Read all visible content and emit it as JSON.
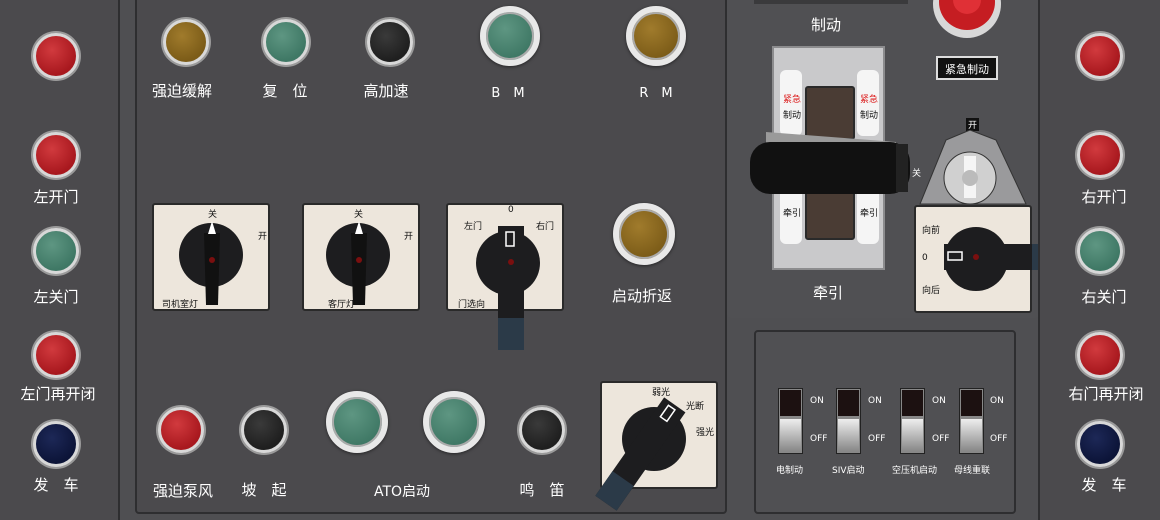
{
  "left_panel": {
    "buttons": [
      {
        "label": "",
        "color": "#a8181e"
      },
      {
        "label": "左开门",
        "color": "#a8181e"
      },
      {
        "label": "左关门",
        "color": "#3f7865"
      },
      {
        "label": "左门再开闭",
        "color": "#a8181e"
      },
      {
        "label": "发　车",
        "color": "#0c1438"
      }
    ]
  },
  "right_panel": {
    "buttons": [
      {
        "label": "",
        "color": "#a8181e"
      },
      {
        "label": "右开门",
        "color": "#a8181e"
      },
      {
        "label": "右关门",
        "color": "#3f7865"
      },
      {
        "label": "右门再开闭",
        "color": "#a8181e"
      },
      {
        "label": "发　车",
        "color": "#0c1438"
      }
    ]
  },
  "main": {
    "top_buttons": [
      {
        "label": "强迫缓解",
        "color": "gold"
      },
      {
        "label": "复　位",
        "color": "green"
      },
      {
        "label": "高加速",
        "color": "dark"
      },
      {
        "label": "B　M",
        "color": "green"
      },
      {
        "label": "R　M",
        "color": "gold"
      }
    ],
    "cab_light_switch": {
      "off": "关",
      "on": "开",
      "name": "司机室灯"
    },
    "saloon_light_switch": {
      "off": "关",
      "on": "开",
      "name": "客厅灯"
    },
    "door_select_switch": {
      "zero": "0",
      "left": "左门",
      "right": "右门",
      "name": "门选向"
    },
    "turnback": {
      "label": "启动折返"
    },
    "bottom_buttons": [
      {
        "label": "强迫泵风",
        "color": "red"
      },
      {
        "label": "坡　起",
        "color": "dark"
      },
      {
        "label": "ATO启动",
        "color": "green"
      },
      {
        "label": "鸣　笛",
        "color": "dark"
      }
    ],
    "headlight_switch": {
      "weak": "弱光",
      "off": "光断",
      "strong": "强光"
    }
  },
  "controller": {
    "brake_label": "制动",
    "traction_label": "牵引",
    "emergency_brake_tag": "紧急",
    "brake_tag": "制动",
    "traction_tag": "牵引",
    "handle_off": "关",
    "emergency_label": "紧急制动"
  },
  "direction": {
    "key_on": "开",
    "forward": "向前",
    "zero": "0",
    "backward": "向后"
  },
  "toggles": [
    {
      "name": "电制动",
      "on": "ON",
      "off": "OFF"
    },
    {
      "name": "SIV启动",
      "on": "ON",
      "off": "OFF"
    },
    {
      "name": "空压机启动",
      "on": "ON",
      "off": "OFF"
    },
    {
      "name": "母线重联",
      "on": "ON",
      "off": "OFF"
    }
  ]
}
